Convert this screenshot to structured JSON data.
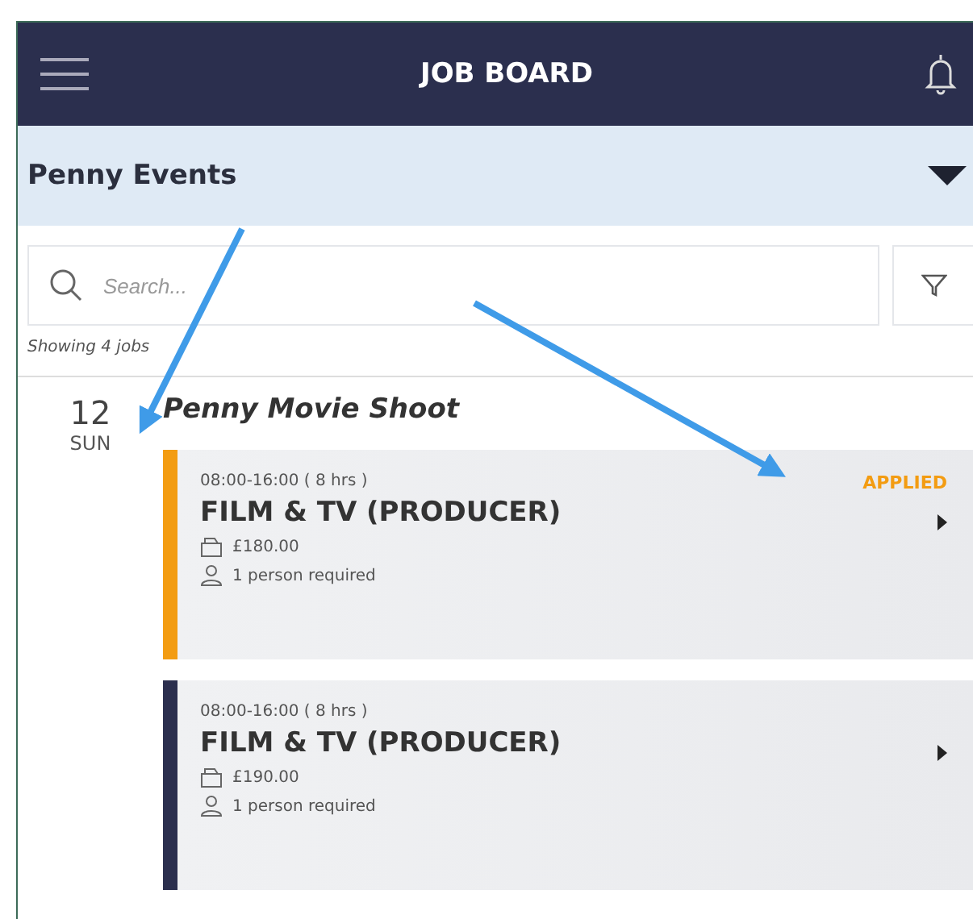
{
  "header": {
    "title": "JOB BOARD"
  },
  "company": {
    "name": "Penny Events"
  },
  "search": {
    "placeholder": "Search..."
  },
  "result_count": "Showing 4 jobs",
  "days": [
    {
      "day": "12",
      "weekday": "SUN",
      "event": "Penny Movie Shoot",
      "jobs": [
        {
          "time": "08:00-16:00 ( 8 hrs )",
          "title": "FILM & TV (PRODUCER)",
          "pay": "£180.00",
          "people": "1 person required",
          "status": "APPLIED",
          "color": "#f39c12"
        },
        {
          "time": "08:00-16:00 ( 8 hrs )",
          "title": "FILM & TV (PRODUCER)",
          "pay": "£190.00",
          "people": "1 person required",
          "color": "#2b2f4e"
        }
      ]
    }
  ]
}
